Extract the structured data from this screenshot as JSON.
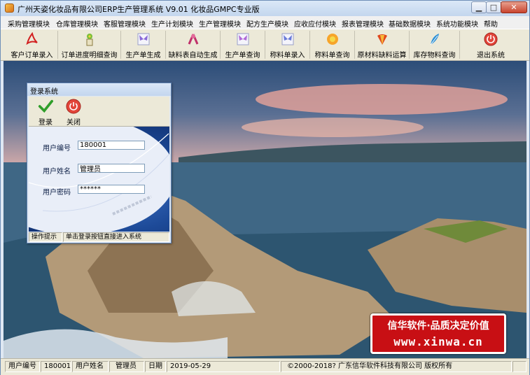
{
  "window": {
    "title": "广州天姿化妆品有限公司ERP生产管理系统  V9.01 化妆品GMPC专业版",
    "min_label": "▁",
    "max_label": "□",
    "close_label": "✕"
  },
  "menu": [
    "采购管理模块",
    "仓库管理模块",
    "客服管理模块",
    "生产计划模块",
    "生产管理模块",
    "配方生产模块",
    "应收应付模块",
    "报表管理模块",
    "基础数据模块",
    "系统功能模块",
    "帮助"
  ],
  "toolbar": [
    {
      "label": "客户订单录入",
      "icon": "pdf-icon"
    },
    {
      "label": "订单进度明细查询",
      "icon": "flower-vase-icon"
    },
    {
      "label": "生产单生成",
      "icon": "butterfly-icon"
    },
    {
      "label": "缺料表自动生成",
      "icon": "ribbon-icon"
    },
    {
      "label": "生产单查询",
      "icon": "butterfly-icon"
    },
    {
      "label": "称料单录入",
      "icon": "butterfly-icon"
    },
    {
      "label": "称料单查询",
      "icon": "sun-flower-icon"
    },
    {
      "label": "原材料缺料运算",
      "icon": "fan-icon"
    },
    {
      "label": "库存物料查询",
      "icon": "feather-icon"
    },
    {
      "label": "退出系统",
      "icon": "power-icon"
    }
  ],
  "login": {
    "title": "登录系统",
    "login_button": "登录",
    "close_button": "关闭",
    "user_id_label": "用户编号",
    "user_id_value": "180001",
    "user_name_label": "用户姓名",
    "user_name_value": "管理员",
    "password_label": "用户密码",
    "password_value": "******",
    "hint_label": "操作提示",
    "hint_text": "单击登录按钮直接进入系统"
  },
  "statusbar": {
    "user_id_label": "用户编号",
    "user_id": "180001",
    "user_name_label": "用户姓名",
    "user_name": "管理员",
    "date_label": "日期",
    "date": "2019-05-29",
    "copyright": "©2000-2018?  广东信华软件科技有限公司   版权所有"
  },
  "ad": {
    "slogan": "信华软件·品质决定价值",
    "url": "www.xinwa.cn"
  },
  "colors": {
    "ad_red": "#c80f14",
    "titlebar": "#c3d6ee",
    "toolbar": "#ece9d8"
  }
}
